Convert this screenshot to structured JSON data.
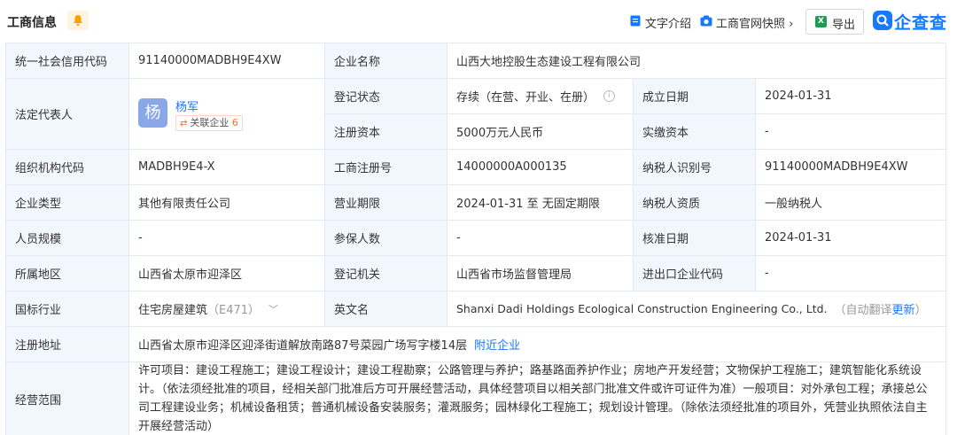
{
  "header": {
    "title": "工商信息",
    "text_intro": "文字介绍",
    "snapshot": "工商官网快照",
    "export": "导出",
    "logo": "企查查"
  },
  "colors": {
    "accent": "#1677ff",
    "label_bg": "#f2f7fd",
    "border": "#e4e9f1"
  },
  "labels": {
    "credit_code": "统一社会信用代码",
    "company_name": "企业名称",
    "legal_rep": "法定代表人",
    "reg_status": "登记状态",
    "founded": "成立日期",
    "reg_capital": "注册资本",
    "paid_capital": "实缴资本",
    "org_code": "组织机构代码",
    "reg_no": "工商注册号",
    "taxpayer_id": "纳税人识别号",
    "company_type": "企业类型",
    "term": "营业期限",
    "taxpayer_qual": "纳税人资质",
    "staff_size": "人员规模",
    "insured": "参保人数",
    "approval_date": "核准日期",
    "region": "所属地区",
    "reg_authority": "登记机关",
    "ie_code": "进出口企业代码",
    "industry": "国标行业",
    "english_name": "英文名",
    "address": "注册地址",
    "scope": "经营范围"
  },
  "values": {
    "credit_code": "91140000MADBH9E4XW",
    "company_name": "山西大地控股生态建设工程有限公司",
    "legal_rep_avatar": "杨",
    "legal_rep_name": "杨军",
    "related_label": "关联企业",
    "related_count": "6",
    "reg_status": "存续（在营、开业、在册）",
    "founded": "2024-01-31",
    "reg_capital": "5000万元人民币",
    "paid_capital": "-",
    "org_code": "MADBH9E4-X",
    "reg_no": "14000000A000135",
    "taxpayer_id": "91140000MADBH9E4XW",
    "company_type": "其他有限责任公司",
    "term": "2024-01-31 至 无固定期限",
    "taxpayer_qual": "一般纳税人",
    "staff_size": "-",
    "insured": "-",
    "approval_date": "2024-01-31",
    "region": "山西省太原市迎泽区",
    "reg_authority": "山西省市场监督管理局",
    "ie_code": "-",
    "industry": "住宅房屋建筑",
    "industry_code": "（E471）",
    "english_name": "Shanxi Dadi Holdings Ecological Construction Engineering Co., Ltd.",
    "english_auto": "（自动翻译",
    "english_update": "更新",
    "english_close": "）",
    "address": "山西省太原市迎泽区迎泽街道解放南路87号菜园广场写字楼14层",
    "nearby": "附近企业",
    "scope": "许可项目：建设工程施工；建设工程设计；建设工程勘察；公路管理与养护；路基路面养护作业；房地产开发经营；文物保护工程施工；建筑智能化系统设计。（依法须经批准的项目，经相关部门批准后方可开展经营活动，具体经营项目以相关部门批准文件或许可证件为准）一般项目：对外承包工程；承接总公司工程建设业务；机械设备租赁；普通机械设备安装服务；灌溉服务；园林绿化工程施工；规划设计管理。（除依法须经批准的项目外，凭营业执照依法自主开展经营活动）"
  }
}
